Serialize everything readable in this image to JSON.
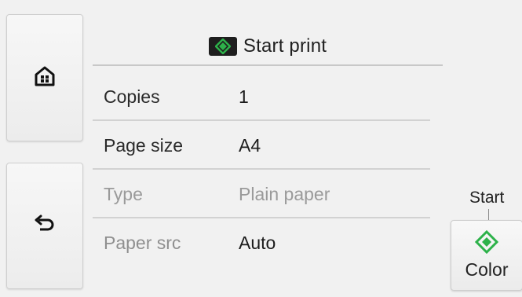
{
  "header": {
    "title": "Start print",
    "icon": "start-diamond-icon"
  },
  "nav": {
    "home_icon": "home-icon",
    "back_icon": "back-arrow-icon"
  },
  "settings": {
    "rows": [
      {
        "label": "Copies",
        "value": "1",
        "enabled": true
      },
      {
        "label": "Page size",
        "value": "A4",
        "enabled": true
      },
      {
        "label": "Type",
        "value": "Plain paper",
        "enabled": false
      },
      {
        "label": "Paper src",
        "value": "Auto",
        "enabled": true
      }
    ]
  },
  "start": {
    "label": "Start",
    "button_label": "Color",
    "icon": "start-diamond-icon"
  },
  "colors": {
    "accent_green": "#2db24a",
    "icon_dark": "#1e1e1e"
  }
}
